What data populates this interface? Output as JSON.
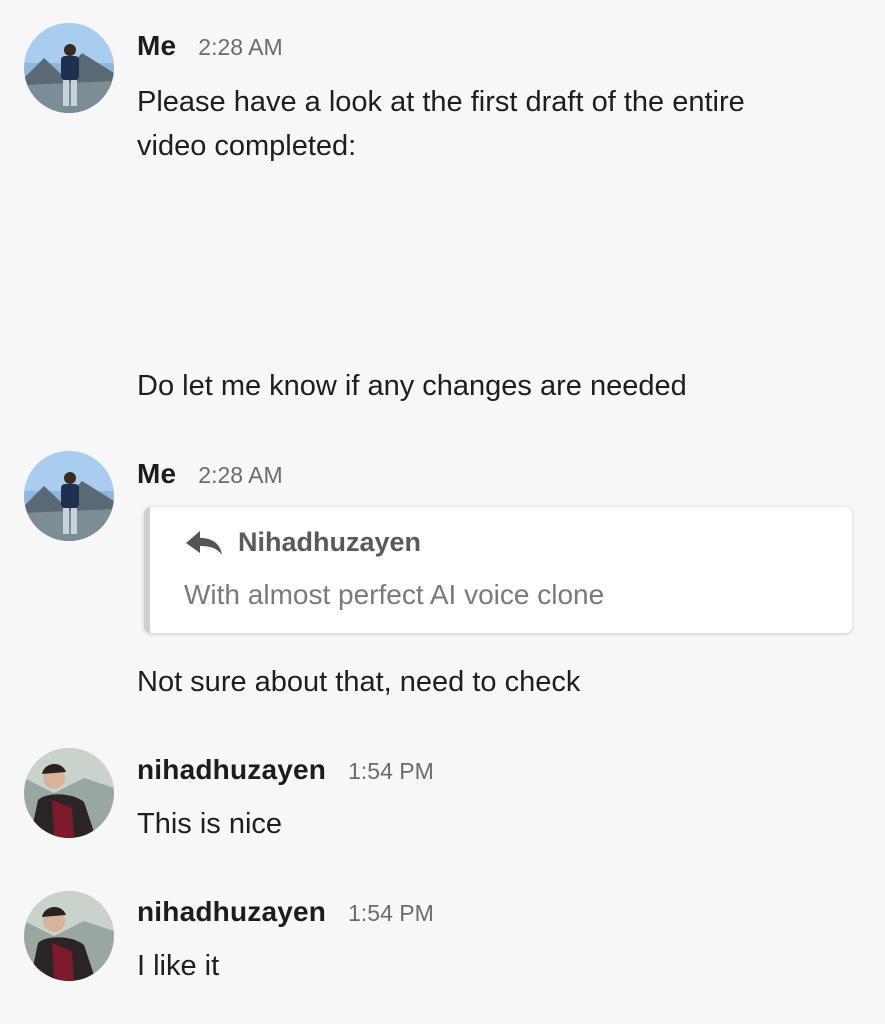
{
  "messages": [
    {
      "sender": "Me",
      "time": "2:28 AM",
      "avatar": "profile-photo-me",
      "text_line1": "Please have a look at the first draft of the entire",
      "text_line2": "video completed:",
      "text_after": "Do let me know if any changes are needed"
    },
    {
      "sender": "Me",
      "time": "2:28 AM",
      "avatar": "profile-photo-me",
      "quote": {
        "icon": "reply-arrow-icon",
        "author": "Nihadhuzayen",
        "text": "With almost perfect AI voice clone"
      },
      "text": "Not sure about that, need to check"
    },
    {
      "sender": "nihadhuzayen",
      "time": "1:54 PM",
      "avatar": "profile-photo-nihadhuzayen",
      "text": "This is nice"
    },
    {
      "sender": "nihadhuzayen",
      "time": "1:54 PM",
      "avatar": "profile-photo-nihadhuzayen",
      "text": "I like it"
    }
  ]
}
